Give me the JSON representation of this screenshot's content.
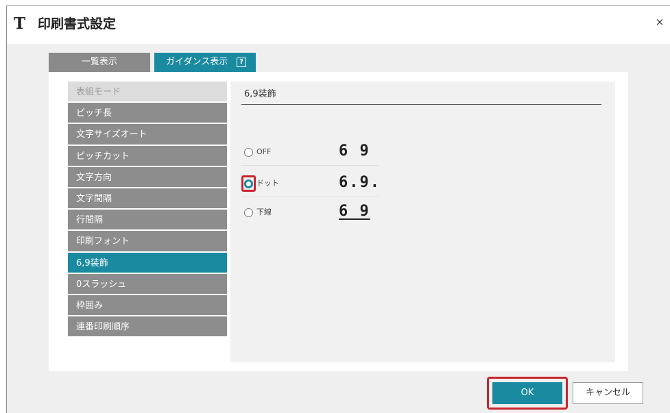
{
  "window": {
    "app_icon": "T",
    "title": "印刷書式設定",
    "close": "×"
  },
  "tabs": {
    "list_label": "一覧表示",
    "guide_label": "ガイダンス表示",
    "help_glyph": "?"
  },
  "sidebar": {
    "items": [
      {
        "label": "表組モード"
      },
      {
        "label": "ピッチ長"
      },
      {
        "label": "文字サイズオート"
      },
      {
        "label": "ピッチカット"
      },
      {
        "label": "文字方向"
      },
      {
        "label": "文字間隔"
      },
      {
        "label": "行間隔"
      },
      {
        "label": "印刷フォント"
      },
      {
        "label": "6,9装飾"
      },
      {
        "label": "0スラッシュ"
      },
      {
        "label": "枠囲み"
      },
      {
        "label": "連番印刷順序"
      }
    ],
    "selected": "6,9装飾"
  },
  "content": {
    "title": "6,9装飾",
    "options": [
      {
        "label": "OFF",
        "sample": "6 9",
        "checked": false
      },
      {
        "label": "ドット",
        "sample": "6.9.",
        "checked": true
      },
      {
        "label": "下線",
        "sample": "6 9",
        "checked": false
      }
    ]
  },
  "buttons": {
    "ok": "OK",
    "cancel": "キャンセル"
  },
  "colors": {
    "accent": "#1a8aa1",
    "highlight": "#c9242d",
    "sidebar_gray": "#8d8d8d"
  }
}
